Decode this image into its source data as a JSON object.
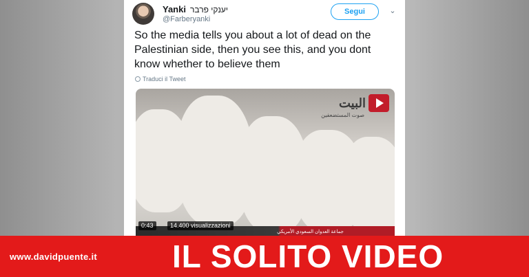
{
  "tweet": {
    "display_name": "Yanki",
    "hebrew_name": "יענקי פרבר",
    "handle": "@Farberyanki",
    "follow_label": "Segui",
    "chevron_icon": "chevron-down-icon",
    "text": "So the media tells you about a lot of dead on the Palestinian side, then you see this, and you dont know whether to believe them",
    "translate_label": "Traduci il Tweet",
    "accent_color": "#1da1f2"
  },
  "video": {
    "duration": "0:43",
    "views": "14.400 visualizzazioni",
    "channel_logo_text": "البيت",
    "channel_logo_sub": "صوت المستضعفين",
    "ticker_text": "جماعة العدوان السعودي الأمريكي"
  },
  "banner": {
    "site": "www.davidpuente.it",
    "headline": "IL SOLITO VIDEO",
    "color": "#e31a1a"
  }
}
